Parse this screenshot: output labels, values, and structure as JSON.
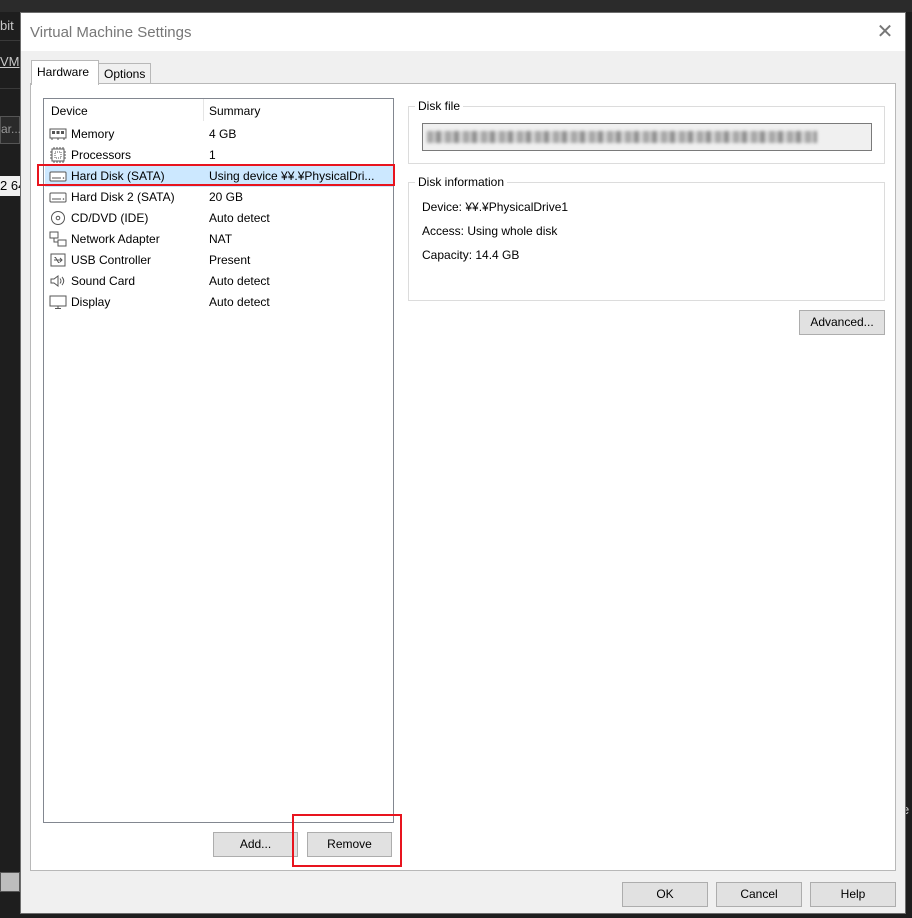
{
  "background": {
    "frag_top": "bit",
    "frag_vm": "VM",
    "frag_input": "ar...",
    "frag_chip": "2 64",
    "frag_right": "e"
  },
  "dialog": {
    "title": "Virtual Machine Settings",
    "close_glyph": "✕"
  },
  "tabs": [
    {
      "label": "Hardware",
      "active": true
    },
    {
      "label": "Options",
      "active": false
    }
  ],
  "device_list": {
    "columns": [
      "Device",
      "Summary"
    ],
    "rows": [
      {
        "device": "Memory",
        "summary": "4 GB",
        "icon": "memory-icon"
      },
      {
        "device": "Processors",
        "summary": "1",
        "icon": "processor-icon"
      },
      {
        "device": "Hard Disk (SATA)",
        "summary": "Using device ¥¥.¥PhysicalDri...",
        "icon": "hard-disk-icon",
        "selected": true
      },
      {
        "device": "Hard Disk 2 (SATA)",
        "summary": "20 GB",
        "icon": "hard-disk-icon"
      },
      {
        "device": "CD/DVD (IDE)",
        "summary": "Auto detect",
        "icon": "cd-dvd-icon"
      },
      {
        "device": "Network Adapter",
        "summary": "NAT",
        "icon": "network-adapter-icon"
      },
      {
        "device": "USB Controller",
        "summary": "Present",
        "icon": "usb-icon"
      },
      {
        "device": "Sound Card",
        "summary": "Auto detect",
        "icon": "speaker-icon"
      },
      {
        "device": "Display",
        "summary": "Auto detect",
        "icon": "monitor-icon"
      }
    ]
  },
  "buttons": {
    "add": "Add...",
    "remove": "Remove",
    "advanced": "Advanced...",
    "ok": "OK",
    "cancel": "Cancel",
    "help": "Help"
  },
  "disk_file": {
    "label": "Disk file"
  },
  "disk_info": {
    "label": "Disk information",
    "device": "Device:  ¥¥.¥PhysicalDrive1",
    "access": "Access:  Using whole disk",
    "capacity": "Capacity:  14.4 GB"
  },
  "colors": {
    "highlight": "#e8141e",
    "selection": "#cce8ff"
  }
}
